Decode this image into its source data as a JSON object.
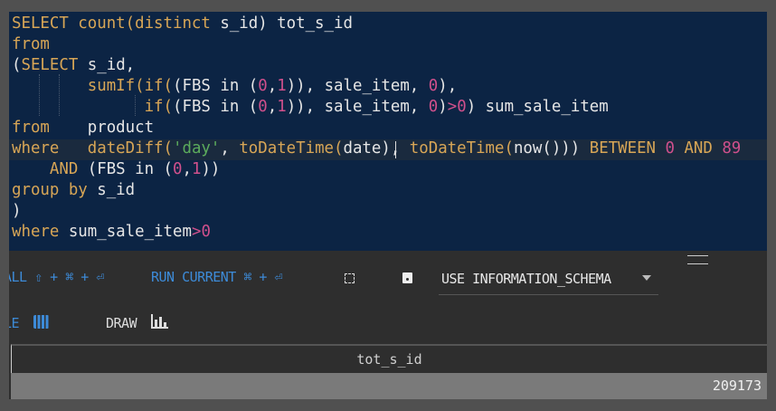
{
  "editor": {
    "lines": [
      [
        [
          "SELECT ",
          "kw"
        ],
        [
          "count(distinct ",
          "kw"
        ],
        [
          "s_id) tot_s_id",
          "id"
        ]
      ],
      [
        [
          "from",
          "kw"
        ]
      ],
      [
        [
          "(",
          "id"
        ],
        [
          "SELECT ",
          "kw"
        ],
        [
          "s_id,",
          "id"
        ]
      ],
      [
        [
          "        sumIf(if(",
          "kw"
        ],
        [
          "(FBS in (",
          "id"
        ],
        [
          "0",
          "num"
        ],
        [
          ",",
          "id"
        ],
        [
          "1",
          "num"
        ],
        [
          ")), sale_item, ",
          "id"
        ],
        [
          "0",
          "num"
        ],
        [
          "),",
          "id"
        ]
      ],
      [
        [
          "              if(",
          "kw"
        ],
        [
          "(FBS in (",
          "id"
        ],
        [
          "0",
          "num"
        ],
        [
          ",",
          "id"
        ],
        [
          "1",
          "num"
        ],
        [
          ")), sale_item, ",
          "id"
        ],
        [
          "0",
          "num"
        ],
        [
          ")",
          "id"
        ],
        [
          ">",
          "op"
        ],
        [
          "0",
          "num"
        ],
        [
          ") sum_sale_item",
          "id"
        ]
      ],
      [
        [
          "from",
          "kw"
        ],
        [
          "    product",
          "id"
        ]
      ],
      [
        [
          "where",
          "kw"
        ],
        [
          "   dateDiff(",
          "kw"
        ],
        [
          "'day'",
          "str"
        ],
        [
          ", ",
          "id"
        ],
        [
          "toDateTime(",
          "kw"
        ],
        [
          "date), ",
          "id"
        ],
        [
          "toDateTime(",
          "kw"
        ],
        [
          "now())) ",
          "id"
        ],
        [
          "BETWEEN ",
          "kw"
        ],
        [
          "0",
          "num"
        ],
        [
          " AND ",
          "kw"
        ],
        [
          "89",
          "num"
        ]
      ],
      [
        [
          "    AND ",
          "kw"
        ],
        [
          "(FBS in (",
          "id"
        ],
        [
          "0",
          "num"
        ],
        [
          ",",
          "id"
        ],
        [
          "1",
          "num"
        ],
        [
          "))",
          "id"
        ]
      ],
      [
        [
          "group by ",
          "kw"
        ],
        [
          "s_id",
          "id"
        ]
      ],
      [
        [
          ")",
          "id"
        ]
      ],
      [
        [
          "where ",
          "kw"
        ],
        [
          "sum_sale_item",
          "id"
        ],
        [
          ">",
          "op"
        ],
        [
          "0",
          "num"
        ]
      ]
    ]
  },
  "toolbar": {
    "run_all": "ALL ⇧ + ⌘ + ⏎",
    "run_current": "RUN CURRENT ⌘ + ⏎",
    "database_select": "USE INFORMATION_SCHEMA"
  },
  "view_tabs": {
    "table": "LE",
    "draw": "DRAW"
  },
  "results": {
    "columns": [
      "tot_s_id"
    ],
    "rows": [
      [
        "209173"
      ]
    ]
  },
  "colors": {
    "editor_bg": "#0c2444",
    "keyword": "#d8a656",
    "number": "#d0508c",
    "string": "#5cab5c",
    "accent": "#3d8bd8"
  }
}
